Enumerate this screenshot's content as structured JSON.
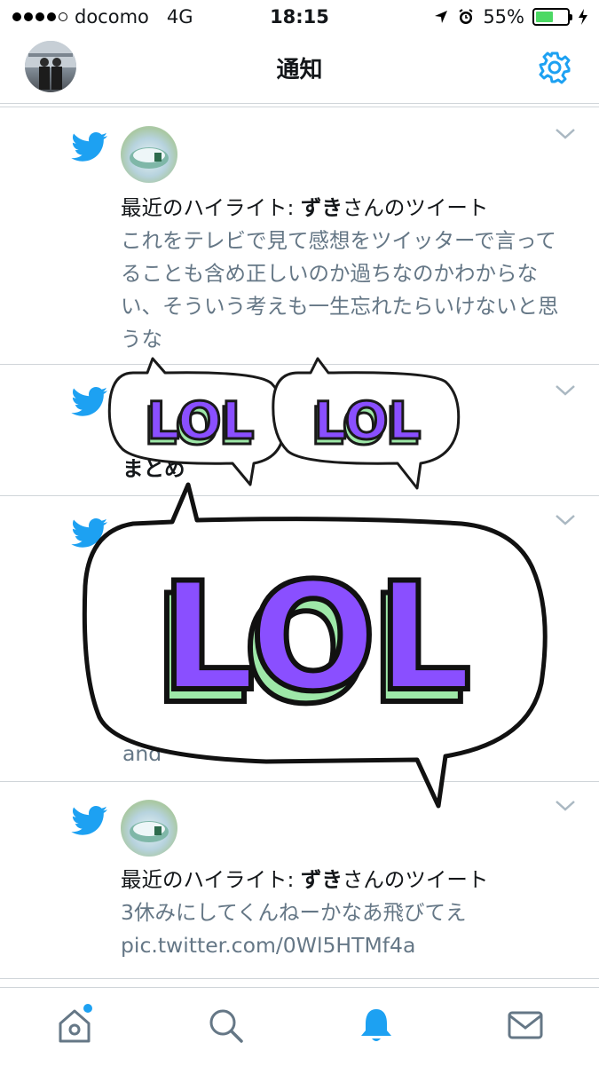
{
  "statusbar": {
    "carrier": "docomo",
    "network": "4G",
    "time": "18:15",
    "battery": "55%",
    "battery_level": 0.55
  },
  "header": {
    "title": "通知"
  },
  "notifications": [
    {
      "prefix": "最近のハイライト: ",
      "user": "ずき",
      "suffix": "さんのツイート",
      "text": "これをテレビで見て感想をツイッターで言ってることも含め正しいのか過ちなのかわからない、そういう考えも一生忘れたらいけないと思うな"
    },
    {
      "partial": "まとめ"
    },
    {
      "partial": "and"
    },
    {
      "prefix": "最近のハイライト: ",
      "user": "ずき",
      "suffix": "さんのツイート",
      "text": "3休みにしてくんねーかなあ飛びてえ",
      "link": "pic.twitter.com/0Wl5HTMf4a"
    }
  ],
  "stickers": [
    {
      "text": "LOL"
    },
    {
      "text": "LOL"
    },
    {
      "text": "LOL"
    }
  ],
  "colors": {
    "accent": "#1da1f2",
    "lol_fill": "#8a4fff",
    "lol_shadow": "#9ee8a8"
  },
  "tabs": [
    {
      "icon": "home-icon"
    },
    {
      "icon": "search-icon"
    },
    {
      "icon": "bell-icon"
    },
    {
      "icon": "mail-icon"
    }
  ]
}
